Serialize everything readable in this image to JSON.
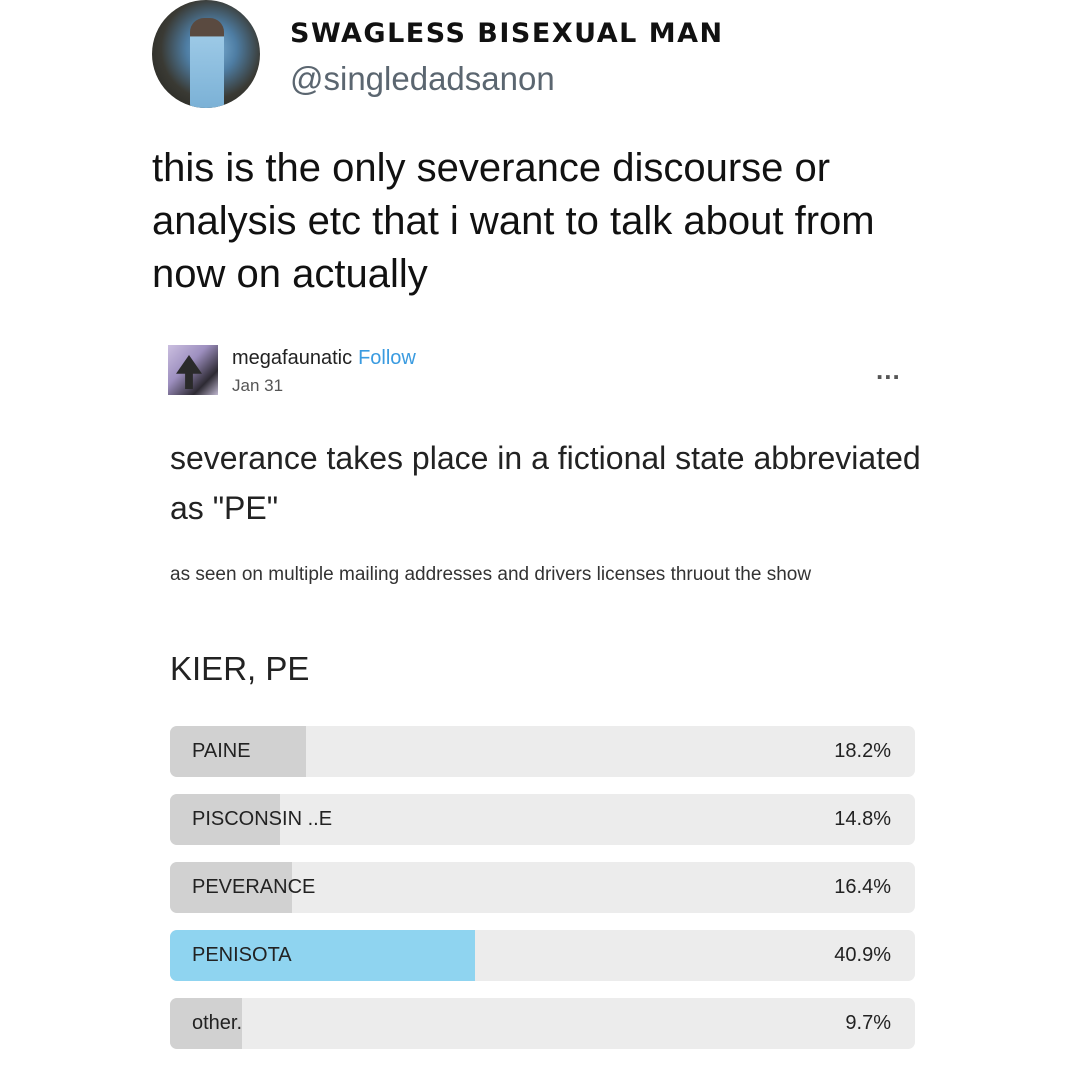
{
  "tweet": {
    "display_name": "SWAGLESS BISEXUAL MAN",
    "handle": "@singledadsanon",
    "text": "this is the only severance discourse or analysis etc that i want to talk about from now on actually"
  },
  "tumblr_post": {
    "username": "megafaunatic",
    "follow_label": "Follow",
    "date": "Jan 31",
    "more_label": "...",
    "title": "severance takes place in a fictional state abbreviated as \"PE\"",
    "body": "as seen on multiple mailing addresses and drivers licenses thruout the show",
    "poll": {
      "question": "KIER, PE",
      "options": [
        {
          "label": "PAINE",
          "percent": "18.2%",
          "value": 18.2,
          "selected": false
        },
        {
          "label": "PISCONSIN ..E",
          "percent": "14.8%",
          "value": 14.8,
          "selected": false
        },
        {
          "label": "PEVERANCE",
          "percent": "16.4%",
          "value": 16.4,
          "selected": false
        },
        {
          "label": "PENISOTA",
          "percent": "40.9%",
          "value": 40.9,
          "selected": true
        },
        {
          "label": "other.",
          "percent": "9.7%",
          "value": 9.7,
          "selected": false
        }
      ]
    }
  },
  "colors": {
    "selected_fill": "#8fd4f0",
    "bar_fill": "#d1d1d1",
    "bar_track": "#ececec",
    "follow_link": "#3a9be0"
  }
}
